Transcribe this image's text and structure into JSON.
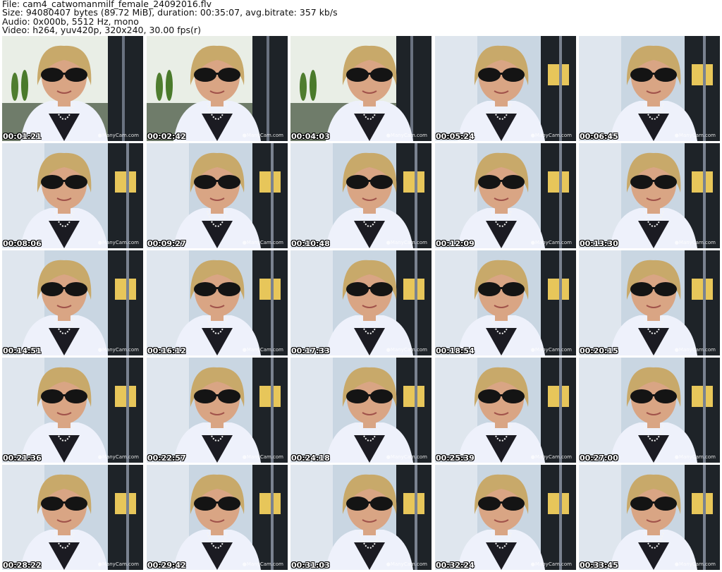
{
  "header": {
    "file_line": "File: cam4_catwomanmilf_female_24092016.flv",
    "size_line": "Size: 94080407 bytes (89.72 MiB), duration: 00:35:07, avg.bitrate: 357 kb/s",
    "audio_line": "Audio: 0x000b, 5512 Hz, mono",
    "video_line": "Video: h264, yuv420p, 320x240, 30.00 fps(r)"
  },
  "watermark": "ManyCam.com",
  "colors": {
    "wall": "#c9d6e2",
    "sky": "#f2f4ef",
    "hair": "#c8a96a",
    "skin": "#d9a584",
    "cardigan": "#eef1fb",
    "glasses": "#141414",
    "dark": "#1e2328"
  },
  "frames": [
    {
      "time": "00:01:21",
      "scene": "trees",
      "glasses": true
    },
    {
      "time": "00:02:42",
      "scene": "trees",
      "glasses": true
    },
    {
      "time": "00:04:03",
      "scene": "trees",
      "glasses": true
    },
    {
      "time": "00:05:24",
      "scene": "building",
      "glasses": true
    },
    {
      "time": "00:06:45",
      "scene": "building",
      "glasses": true
    },
    {
      "time": "00:08:06",
      "scene": "building",
      "glasses": true
    },
    {
      "time": "00:09:27",
      "scene": "building",
      "glasses": true
    },
    {
      "time": "00:10:48",
      "scene": "building",
      "glasses": true
    },
    {
      "time": "00:12:09",
      "scene": "building",
      "glasses": true
    },
    {
      "time": "00:13:30",
      "scene": "building",
      "glasses": true
    },
    {
      "time": "00:14:51",
      "scene": "building",
      "glasses": true
    },
    {
      "time": "00:16:12",
      "scene": "building",
      "glasses": true
    },
    {
      "time": "00:17:33",
      "scene": "building",
      "glasses": true
    },
    {
      "time": "00:18:54",
      "scene": "building",
      "glasses": true
    },
    {
      "time": "00:20:15",
      "scene": "building",
      "glasses": true
    },
    {
      "time": "00:21:36",
      "scene": "building",
      "glasses": true
    },
    {
      "time": "00:22:57",
      "scene": "building",
      "glasses": true
    },
    {
      "time": "00:24:18",
      "scene": "building",
      "glasses": true
    },
    {
      "time": "00:25:39",
      "scene": "building",
      "glasses": true
    },
    {
      "time": "00:27:00",
      "scene": "building",
      "glasses": true
    },
    {
      "time": "00:28:22",
      "scene": "building",
      "glasses": true
    },
    {
      "time": "00:29:42",
      "scene": "building",
      "glasses": true
    },
    {
      "time": "00:31:03",
      "scene": "building",
      "glasses": true
    },
    {
      "time": "00:32:24",
      "scene": "building",
      "glasses": true
    },
    {
      "time": "00:33:45",
      "scene": "building",
      "glasses": true
    }
  ]
}
